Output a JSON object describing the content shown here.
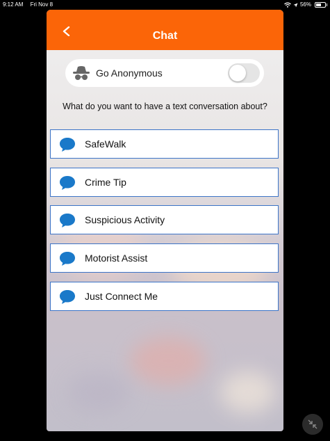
{
  "status_bar": {
    "time": "9:12 AM",
    "date": "Fri Nov 8",
    "battery": "56%",
    "battery_level": 0.56
  },
  "header": {
    "title": "Chat",
    "back_icon": "chevron-left-icon",
    "color": "#fb6508"
  },
  "anonymous": {
    "label": "Go Anonymous",
    "icon": "incognito-icon",
    "enabled": false
  },
  "question": "What do you want to have a text conversation about?",
  "options": [
    {
      "label": "SafeWalk",
      "icon": "chat-bubble-icon"
    },
    {
      "label": "Crime Tip",
      "icon": "chat-bubble-icon"
    },
    {
      "label": "Suspicious Activity",
      "icon": "chat-bubble-icon"
    },
    {
      "label": "Motorist Assist",
      "icon": "chat-bubble-icon"
    },
    {
      "label": "Just Connect Me",
      "icon": "chat-bubble-icon"
    }
  ],
  "colors": {
    "accent": "#fb6508",
    "option_border": "#3b73c7",
    "icon_blue": "#1a79c9"
  },
  "collapse_icon": "collapse-arrows-icon"
}
